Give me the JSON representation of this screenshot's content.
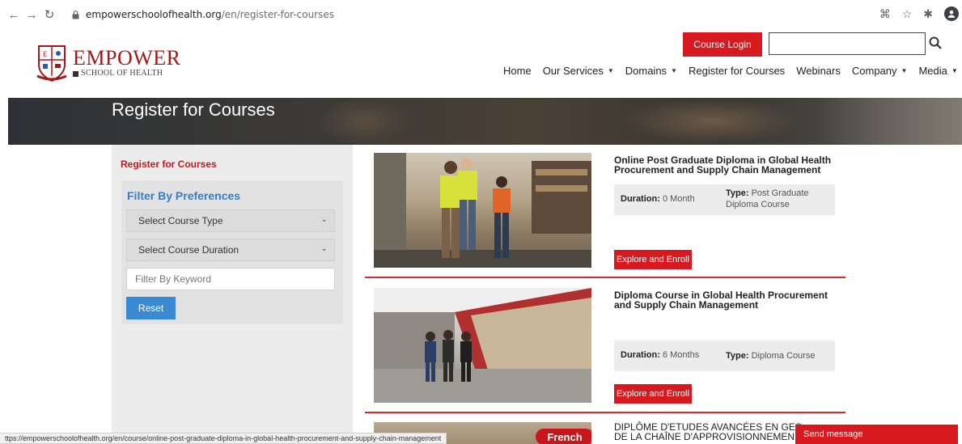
{
  "browser": {
    "url_domain": "empowerschoolofhealth.org",
    "url_path": "/en/register-for-courses"
  },
  "logo": {
    "title": "EMPOWER",
    "subtitle": "SCHOOL OF HEALTH"
  },
  "header": {
    "course_login": "Course Login",
    "search_value": "",
    "nav": [
      {
        "label": "Home",
        "dropdown": false
      },
      {
        "label": "Our Services",
        "dropdown": true
      },
      {
        "label": "Domains",
        "dropdown": true
      },
      {
        "label": "Register for Courses",
        "dropdown": false
      },
      {
        "label": "Webinars",
        "dropdown": false
      },
      {
        "label": "Company",
        "dropdown": true
      },
      {
        "label": "Media",
        "dropdown": true
      }
    ]
  },
  "hero": {
    "title": "Register for Courses"
  },
  "sidebar": {
    "title": "Register for Courses",
    "filter_title": "Filter By Preferences",
    "course_type": "Select Course Type",
    "course_duration": "Select Course Duration",
    "keyword_placeholder": "Filter By Keyword",
    "reset": "Reset"
  },
  "courses": [
    {
      "title": "Online Post Graduate Diploma in Global Health Procurement and Supply Chain Management",
      "duration_label": "Duration:",
      "duration": "0 Month",
      "type_label": "Type:",
      "type": "Post Graduate Diploma Course",
      "button": "Explore and Enroll"
    },
    {
      "title": "Diploma Course in Global Health Procurement and Supply Chain Management",
      "duration_label": "Duration:",
      "duration": "6 Months",
      "type_label": "Type:",
      "type": "Diploma Course",
      "button": "Explore and Enroll"
    },
    {
      "title_line1": "DIPLÔME D'ETUDES AVANCÉES EN GES",
      "title_line2": "DE LA CHAÎNE D'APPROVISIONNEMEN",
      "badge": "French"
    }
  ],
  "status_bar": {
    "text": "ttps://empowerschoolofhealth.org/en/course/online-post-graduate-diploma-in-global-health-procurement-and-supply-chain-management"
  },
  "chat": {
    "send_message": "Send message"
  }
}
